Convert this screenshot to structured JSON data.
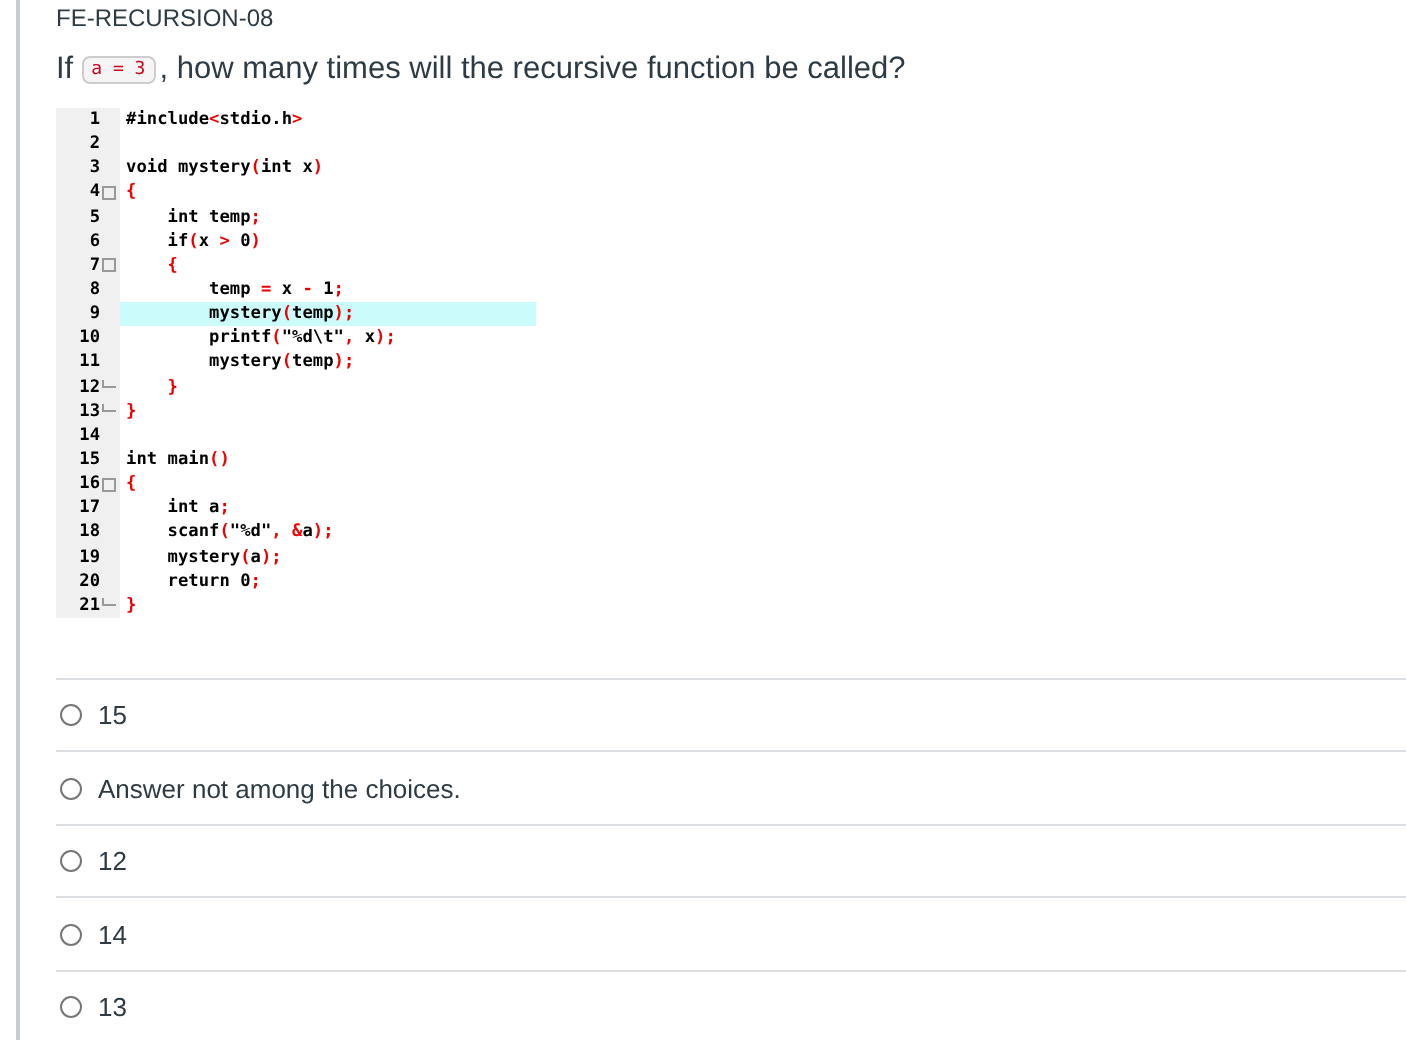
{
  "quiz_title": "FE-RECURSION-08",
  "question": {
    "before": "If",
    "code": "a = 3",
    "after": ", how many times will the recursive function be called?"
  },
  "code_lines": [
    {
      "number": "1",
      "text": "#include<stdio.h>",
      "fold_start": false,
      "fold_end": false,
      "highlighted": false
    },
    {
      "number": "2",
      "fold_start": false,
      "fold_end": false,
      "highlighted": false
    },
    {
      "number": "3",
      "text": "void mystery(int x)",
      "fold_start": false,
      "fold_end": false,
      "highlighted": false
    },
    {
      "number": "4",
      "text": "{",
      "fold_start": true,
      "fold_end": false,
      "highlighted": false
    },
    {
      "number": "5",
      "text": "    int temp;",
      "fold_start": false,
      "fold_end": false,
      "highlighted": false
    },
    {
      "number": "6",
      "text": "    if(x > 0)",
      "fold_start": false,
      "fold_end": false,
      "highlighted": false
    },
    {
      "number": "7",
      "text": "    {",
      "fold_start": true,
      "fold_end": false,
      "highlighted": false
    },
    {
      "number": "8",
      "text": "        temp = x - 1;",
      "fold_start": false,
      "fold_end": false,
      "highlighted": false
    },
    {
      "number": "9",
      "text": "        mystery(temp);",
      "fold_start": false,
      "fold_end": false,
      "highlighted": true
    },
    {
      "number": "10",
      "text": "        printf(\"%d\\t\", x);",
      "fold_start": false,
      "fold_end": false,
      "highlighted": false
    },
    {
      "number": "11",
      "text": "        mystery(temp);",
      "fold_start": false,
      "fold_end": false,
      "highlighted": false
    },
    {
      "number": "12",
      "text": "    }",
      "fold_start": false,
      "fold_end": true,
      "highlighted": false
    },
    {
      "number": "13",
      "text": "}",
      "fold_start": false,
      "fold_end": true,
      "highlighted": false
    },
    {
      "number": "14",
      "fold_start": false,
      "fold_end": false,
      "highlighted": false
    },
    {
      "number": "15",
      "text": "int main()",
      "fold_start": false,
      "fold_end": false,
      "highlighted": false
    },
    {
      "number": "16",
      "text": "{",
      "fold_start": true,
      "fold_end": false,
      "highlighted": false
    },
    {
      "number": "17",
      "text": "    int a;",
      "fold_start": false,
      "fold_end": false,
      "highlighted": false
    },
    {
      "number": "18",
      "text": "    scanf(\"%d\", &a);",
      "fold_start": false,
      "fold_end": false,
      "highlighted": false
    },
    {
      "number": "19",
      "text": "    mystery(a);",
      "fold_start": false,
      "fold_end": false,
      "highlighted": false
    },
    {
      "number": "20",
      "text": "    return 0;",
      "fold_start": false,
      "fold_end": false,
      "highlighted": false
    },
    {
      "number": "21",
      "text": "}",
      "fold_start": false,
      "fold_end": true,
      "highlighted": false
    }
  ],
  "choices": [
    {
      "label": "15",
      "selected": false
    },
    {
      "label": "Answer not among the choices.",
      "selected": false
    },
    {
      "label": "12",
      "selected": false
    },
    {
      "label": "14",
      "selected": false
    },
    {
      "label": "13",
      "selected": false
    }
  ]
}
